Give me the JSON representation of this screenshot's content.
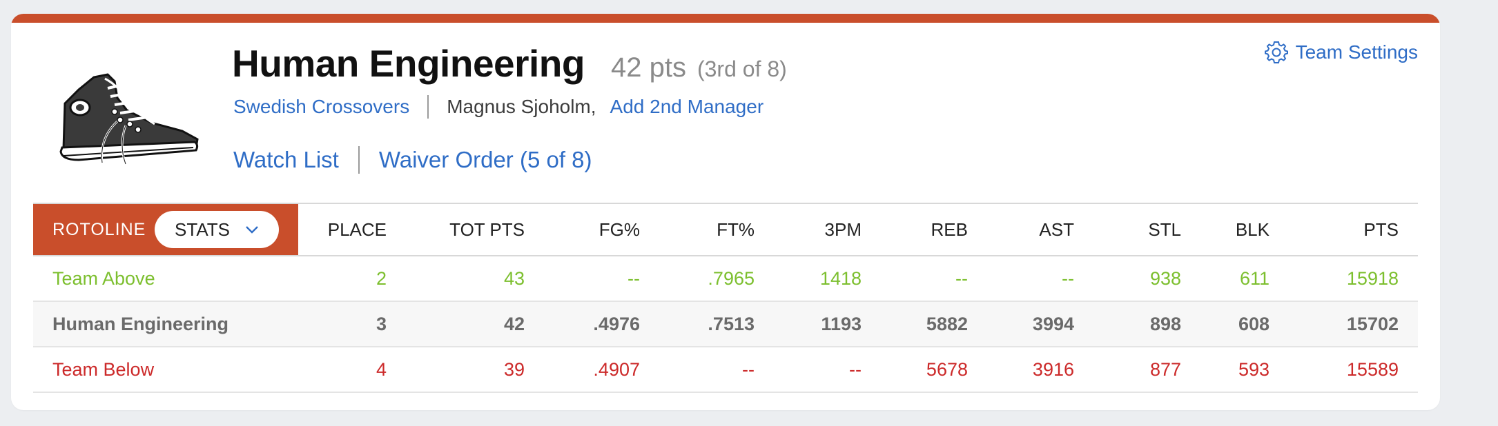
{
  "header": {
    "team_name": "Human Engineering",
    "points": "42 pts",
    "rank": "(3rd of 8)",
    "league": "Swedish Crossovers",
    "manager": "Magnus Sjoholm,",
    "add_manager": "Add 2nd Manager",
    "watch_list": "Watch List",
    "waiver_order": "Waiver Order (5 of 8)",
    "settings": "Team Settings"
  },
  "table": {
    "rotoline": "ROTOLINE",
    "view": "STATS",
    "columns": [
      "PLACE",
      "TOT PTS",
      "FG%",
      "FT%",
      "3PM",
      "REB",
      "AST",
      "STL",
      "BLK",
      "PTS"
    ],
    "rows": [
      {
        "name": "Team Above",
        "cells": [
          "2",
          "43",
          "--",
          ".7965",
          "1418",
          "--",
          "--",
          "938",
          "611",
          "15918"
        ]
      },
      {
        "name": "Human Engineering",
        "cells": [
          "3",
          "42",
          ".4976",
          ".7513",
          "1193",
          "5882",
          "3994",
          "898",
          "608",
          "15702"
        ]
      },
      {
        "name": "Team Below",
        "cells": [
          "4",
          "39",
          ".4907",
          "--",
          "--",
          "5678",
          "3916",
          "877",
          "593",
          "15589"
        ]
      }
    ]
  },
  "colors": {
    "accent": "#c94e2b",
    "link": "#2f6dc6",
    "above": "#7cbf2e",
    "below": "#cc2a2a"
  }
}
